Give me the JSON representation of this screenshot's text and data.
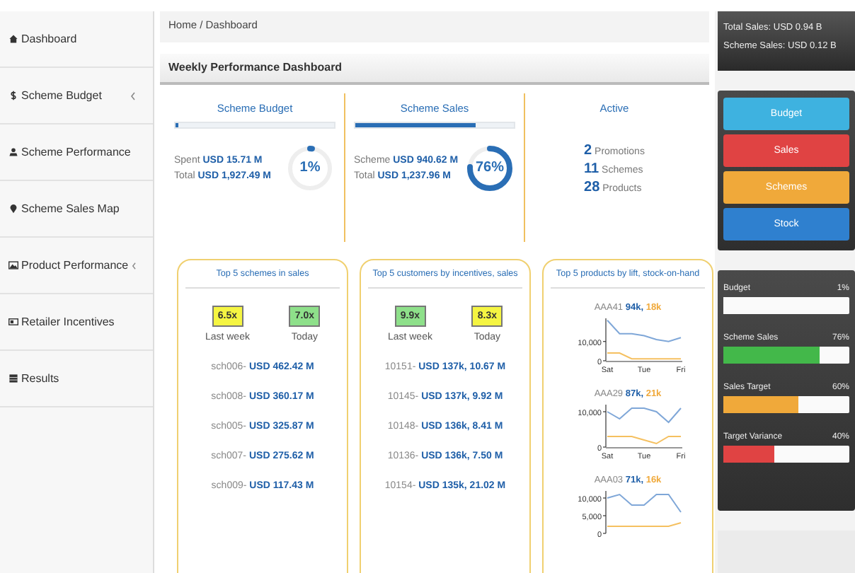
{
  "sidebar": {
    "items": [
      {
        "label": "Dashboard",
        "submenu": false
      },
      {
        "label": "Scheme Budget",
        "submenu": true
      },
      {
        "label": "Scheme Performance",
        "submenu": false
      },
      {
        "label": "Scheme Sales Map",
        "submenu": false
      },
      {
        "label": "Product Performance",
        "submenu": true
      },
      {
        "label": "Retailer Incentives",
        "submenu": false
      },
      {
        "label": "Results",
        "submenu": false
      }
    ]
  },
  "breadcrumb": "Home / Dashboard",
  "panel_title": "Weekly Performance Dashboard",
  "summary": [
    {
      "title": "Scheme Budget",
      "progress": {
        "level": 0.01
      },
      "lines": [
        {
          "label": "Spent",
          "value": "USD 15.71 M"
        },
        {
          "label": "Total",
          "value": "USD 1,927.49 M"
        }
      ],
      "ring": {
        "label": "1%"
      }
    },
    {
      "title": "Scheme Sales",
      "progress": {
        "level": 0.76
      },
      "lines": [
        {
          "label": "Scheme",
          "value": "USD 940.62 M"
        },
        {
          "label": "Total",
          "value": "USD 1,237.96 M"
        }
      ],
      "ring": {
        "label": "76%"
      }
    }
  ],
  "active": {
    "title": "Active",
    "items": [
      {
        "count": "2",
        "label": "Promotions"
      },
      {
        "count": "11",
        "label": "Schemes"
      },
      {
        "count": "28",
        "label": "Products"
      }
    ]
  },
  "cards": [
    {
      "title": "Top 5 schemes in sales",
      "stats": [
        {
          "value": "6.5x",
          "label": "Last week",
          "color": "#f5f542"
        },
        {
          "value": "7.0x",
          "label": "Today",
          "color": "#8ee08a"
        }
      ],
      "rows": [
        {
          "id": "sch006-",
          "value": "USD 462.42 M"
        },
        {
          "id": "sch008-",
          "value": "USD 360.17 M"
        },
        {
          "id": "sch005-",
          "value": "USD 325.87 M"
        },
        {
          "id": "sch007-",
          "value": "USD 275.62 M"
        },
        {
          "id": "sch009-",
          "value": "USD 117.43 M"
        }
      ]
    },
    {
      "title": "Top 5 customers by incentives, sales",
      "stats": [
        {
          "value": "9.9x",
          "label": "Last week",
          "color": "#8ee08a"
        },
        {
          "value": "8.3x",
          "label": "Today",
          "color": "#f5f542"
        }
      ],
      "rows": [
        {
          "id": "10151-",
          "value": "USD 137k, 10.67 M"
        },
        {
          "id": "10145-",
          "value": "USD 137k, 9.92 M"
        },
        {
          "id": "10148-",
          "value": "USD 136k, 8.41 M"
        },
        {
          "id": "10136-",
          "value": "USD 136k, 7.50 M"
        },
        {
          "id": "10154-",
          "value": "USD 135k, 21.02 M"
        }
      ]
    }
  ],
  "products": {
    "title": "Top 5 products by lift, stock-on-hand",
    "items": [
      {
        "name": "AAA41",
        "value1": "94k,",
        "value2": "18k",
        "chart_data": {
          "type": "line",
          "categories": [
            "Sat",
            null,
            null,
            "Tue",
            null,
            null,
            "Fri"
          ],
          "ylim": [
            0,
            22000
          ],
          "yticks": [
            {
              "value": 0,
              "label": "0"
            },
            {
              "value": 10000,
              "label": "10,000"
            }
          ],
          "series": [
            {
              "color": "#7fa7d8",
              "values": [
                21000,
                14000,
                14000,
                13000,
                11000,
                10000,
                12000
              ]
            },
            {
              "color": "#f5c060",
              "values": [
                4000,
                4000,
                1000,
                1000,
                1000,
                1000,
                1000
              ]
            }
          ]
        }
      },
      {
        "name": "AAA29",
        "value1": "87k,",
        "value2": "21k",
        "chart_data": {
          "type": "line",
          "categories": [
            "Sat",
            null,
            null,
            "Tue",
            null,
            null,
            "Fri"
          ],
          "ylim": [
            0,
            12000
          ],
          "yticks": [
            {
              "value": 0,
              "label": "0"
            },
            {
              "value": 10000,
              "label": "10,000"
            }
          ],
          "series": [
            {
              "color": "#7fa7d8",
              "values": [
                10000,
                8000,
                11000,
                11000,
                10000,
                7000,
                11000
              ]
            },
            {
              "color": "#f5c060",
              "values": [
                3000,
                3000,
                3000,
                2000,
                1000,
                3000,
                3000
              ]
            }
          ]
        }
      },
      {
        "name": "AAA03",
        "value1": "71k,",
        "value2": "16k",
        "chart_data": {
          "type": "line",
          "ylim": [
            0,
            12000
          ],
          "yticks": [
            {
              "value": 0,
              "label": "0"
            },
            {
              "value": 5000,
              "label": "5,000"
            },
            {
              "value": 10000,
              "label": "10,000"
            }
          ],
          "series": [
            {
              "color": "#7fa7d8",
              "values": [
                10000,
                11000,
                8000,
                8000,
                11000,
                11000,
                6000
              ]
            },
            {
              "color": "#f5c060",
              "values": [
                2000,
                2000,
                2000,
                2000,
                2000,
                2000,
                3000
              ]
            }
          ]
        }
      }
    ]
  },
  "totals": [
    {
      "label": "Total Sales:",
      "value": "USD 0.94 B"
    },
    {
      "label": "Scheme Sales:",
      "value": "USD 0.12 B"
    }
  ],
  "menu_buttons": [
    {
      "label": "Budget",
      "color": "#3eb2e0"
    },
    {
      "label": "Sales",
      "color": "#e04343"
    },
    {
      "label": "Schemes",
      "color": "#f0a93a"
    },
    {
      "label": "Stock",
      "color": "#2f80cf"
    }
  ],
  "meters": [
    {
      "label": "Budget",
      "reading": "1%",
      "level": 0.01,
      "color": "#ffffff"
    },
    {
      "label": "Scheme Sales",
      "reading": "76%",
      "level": 0.76,
      "color": "#43b84a"
    },
    {
      "label": "Sales Target",
      "reading": "60%",
      "level": 0.6,
      "color": "#f0a93a"
    },
    {
      "label": "Target Variance",
      "reading": "40%",
      "level": 0.4,
      "color": "#e04343"
    }
  ]
}
